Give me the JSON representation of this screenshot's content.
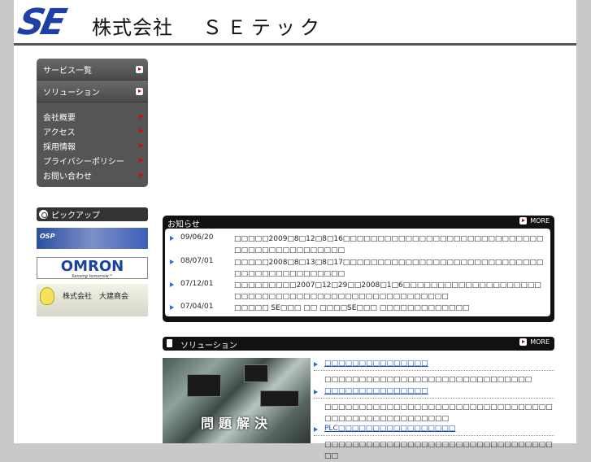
{
  "header": {
    "logo_mark": "SE",
    "company_jp": "株式会社",
    "company_name": "ＳＥテック"
  },
  "menu": {
    "top_items": [
      {
        "label": "サービス一覧"
      },
      {
        "label": "ソリューション"
      }
    ],
    "sub_items": [
      {
        "label": "会社概要"
      },
      {
        "label": "アクセス"
      },
      {
        "label": "採用情報"
      },
      {
        "label": "プライバシーポリシー"
      },
      {
        "label": "お問い合わせ"
      }
    ]
  },
  "pickup": {
    "title": "ピックアップ",
    "banners": {
      "osp": "OSP",
      "omron": "OMRON",
      "omron_tag": "Sensing tomorrow™",
      "daiken": "株式会社　大建商会"
    }
  },
  "news": {
    "title": "お知らせ",
    "more": "MORE",
    "items": [
      {
        "date": "09/06/20",
        "text": "□□□□□2009□8□12□8□16□□□□□□□□□□□□□□□□□□□□□□□□□□□□□□□□□□□□□□□□□□□□□"
      },
      {
        "date": "08/07/01",
        "text": "□□□□□2008□8□13□8□17□□□□□□□□□□□□□□□□□□□□□□□□□□□□□□□□□□□□□□□□□□□□□"
      },
      {
        "date": "07/12/01",
        "text": "□□□□□□□□□2007□12□29□□2008□1□6□□□□□□□□□□□□□□□□□□□□□□□□□□□□□□□□□□□□□□□□□□□□□□□□□□□"
      },
      {
        "date": "07/04/01",
        "text": "□□□□□ SE□□□ □□ □□□□SE□□□ □□□□□□□□□□□□□"
      }
    ]
  },
  "solutions": {
    "title": "ソリューション",
    "more": "MORE",
    "image_caption": "問題解決",
    "items": [
      {
        "link": "□□□□□□□□□□□□□□□",
        "desc": "□□□□□□□□□□□□□□□□□□□□□□□□□□□□□□"
      },
      {
        "link": "□□□□□□□□□□□□□□□",
        "desc": "□□□□□□□□□□□□□□□□□□□□□□□□□□□□□□□□□□□□□□□□□□□□□□□□□□□"
      },
      {
        "link": "PLC□□□□□□□□□□□□□□□□□",
        "desc": "□□□□□□□□□□□□□□□□□□□□□□□□□□□□□□□□□□□"
      }
    ]
  }
}
